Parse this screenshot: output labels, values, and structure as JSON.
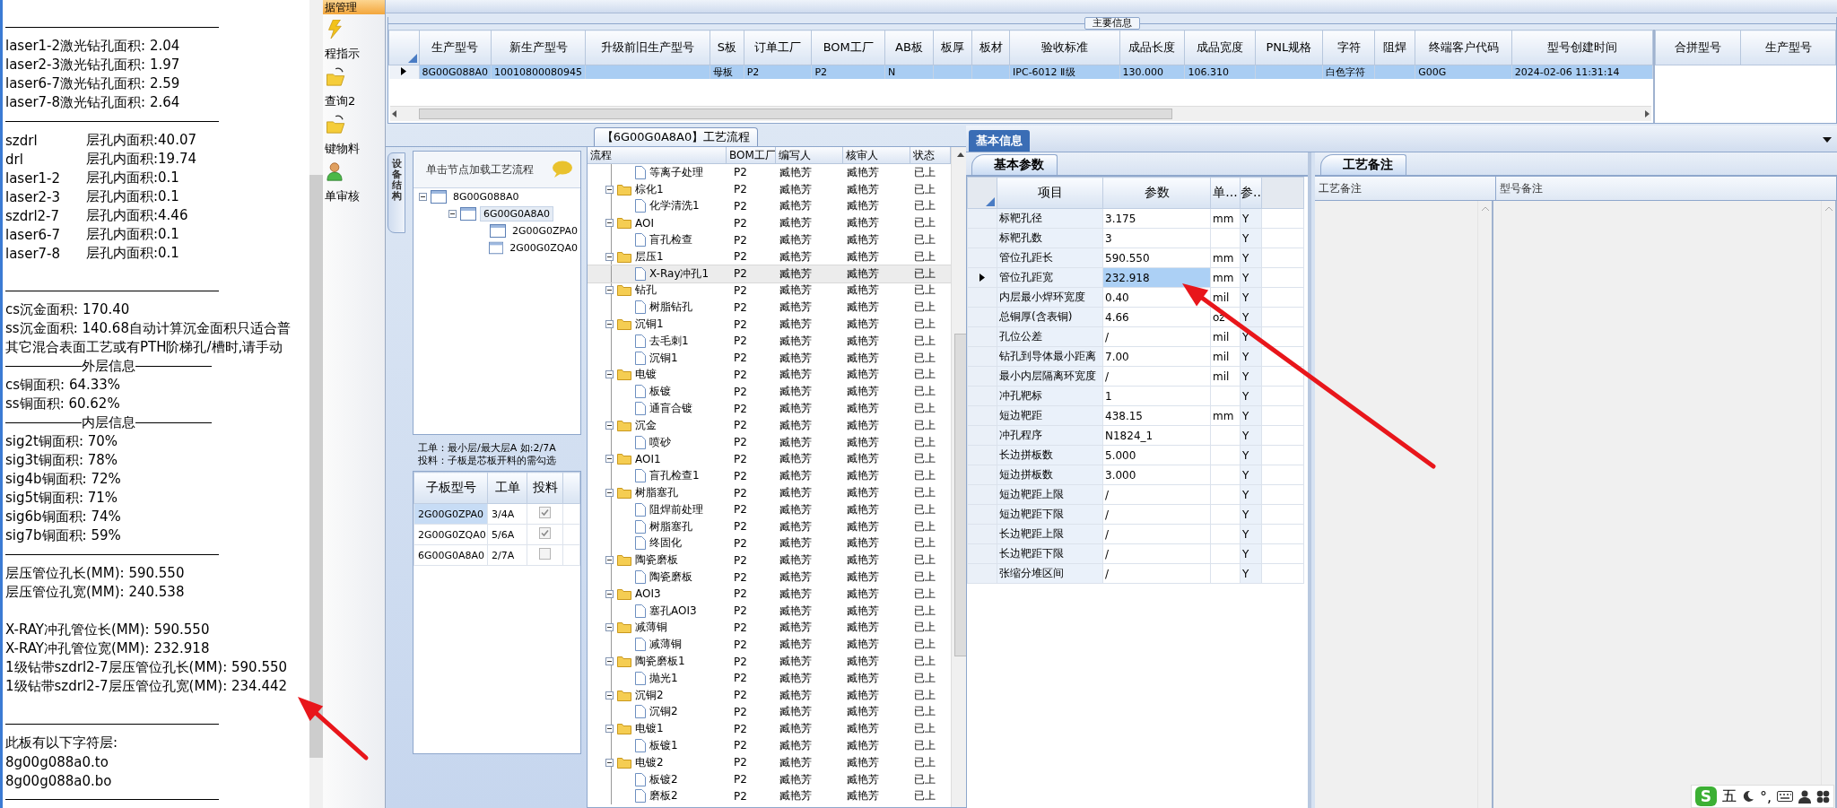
{
  "left_notes": {
    "lines": [
      {
        "kind": "rule"
      },
      {
        "kind": "text",
        "text": "laser1-2激光钻孔面积: 2.04"
      },
      {
        "kind": "text",
        "text": "laser2-3激光钻孔面积: 1.97"
      },
      {
        "kind": "text",
        "text": "laser6-7激光钻孔面积: 2.59"
      },
      {
        "kind": "text",
        "text": "laser7-8激光钻孔面积: 2.64"
      },
      {
        "kind": "rule"
      },
      {
        "kind": "pair",
        "label": "szdrl",
        "value": "层孔内面积:40.07"
      },
      {
        "kind": "pair",
        "label": "drl",
        "value": "层孔内面积:19.74"
      },
      {
        "kind": "pair",
        "label": "laser1-2",
        "value": "层孔内面积:0.1"
      },
      {
        "kind": "pair",
        "label": "laser2-3",
        "value": "层孔内面积:0.1"
      },
      {
        "kind": "pair",
        "label": "szdrl2-7",
        "value": "层孔内面积:4.46"
      },
      {
        "kind": "pair",
        "label": "laser6-7",
        "value": "层孔内面积:0.1"
      },
      {
        "kind": "pair",
        "label": "laser7-8",
        "value": "层孔内面积:0.1"
      },
      {
        "kind": "blank"
      },
      {
        "kind": "rule"
      },
      {
        "kind": "text",
        "text": "cs沉金面积: 170.40"
      },
      {
        "kind": "text",
        "text": "ss沉金面积: 140.68自动计算沉金面积只适合普"
      },
      {
        "kind": "text",
        "text": "其它混合表面工艺或有PTH阶梯孔/槽时,请手动"
      },
      {
        "kind": "heading",
        "text": "外层信息"
      },
      {
        "kind": "text",
        "text": "cs铜面积: 64.33%"
      },
      {
        "kind": "text",
        "text": "ss铜面积: 60.62%"
      },
      {
        "kind": "heading",
        "text": "内层信息"
      },
      {
        "kind": "text",
        "text": "sig2t铜面积: 70%"
      },
      {
        "kind": "text",
        "text": "sig3t铜面积: 78%"
      },
      {
        "kind": "text",
        "text": "sig4b铜面积: 72%"
      },
      {
        "kind": "text",
        "text": "sig5t铜面积: 71%"
      },
      {
        "kind": "text",
        "text": "sig6b铜面积: 74%"
      },
      {
        "kind": "text",
        "text": "sig7b铜面积: 59%"
      },
      {
        "kind": "rule"
      },
      {
        "kind": "text",
        "text": "层压管位孔长(MM): 590.550"
      },
      {
        "kind": "text",
        "text": "层压管位孔宽(MM): 240.538"
      },
      {
        "kind": "blank"
      },
      {
        "kind": "text",
        "text": "X-RAY冲孔管位长(MM): 590.550"
      },
      {
        "kind": "text",
        "text": "X-RAY冲孔管位宽(MM): 232.918"
      },
      {
        "kind": "text",
        "text": "1级钻带szdrl2-7层压管位孔长(MM): 590.550"
      },
      {
        "kind": "text",
        "text": "1级钻带szdrl2-7层压管位孔宽(MM): 234.442"
      },
      {
        "kind": "blank"
      },
      {
        "kind": "rule"
      },
      {
        "kind": "text",
        "text": "此板有以下字符层:"
      },
      {
        "kind": "text",
        "text": "8g00g088a0.to"
      },
      {
        "kind": "text",
        "text": "8g00g088a0.bo"
      },
      {
        "kind": "rule"
      }
    ]
  },
  "side_menu": {
    "header": "据管理",
    "items": [
      {
        "label": "程指示"
      },
      {
        "label": "查询2"
      },
      {
        "label": "键物料"
      },
      {
        "label": "单审核"
      }
    ]
  },
  "top_table": {
    "title": "主要信息",
    "columns": [
      "生产型号",
      "新生产型号",
      "升级前旧生产型号",
      "S板",
      "订单工厂",
      "BOM工厂",
      "AB板",
      "板厚",
      "板材",
      "验收标准",
      "成品长度",
      "成品宽度",
      "PNL规格",
      "字符",
      "阻焊",
      "终端客户代码",
      "型号创建时间"
    ],
    "rows": [
      {
        "selected": true,
        "cells": [
          "8G00G088A0",
          "10010800080945",
          null,
          "母板",
          "P2",
          "P2",
          "N",
          null,
          null,
          "IPC-6012 Ⅱ级",
          "130.000",
          "106.310",
          null,
          "白色字符",
          null,
          "G00G",
          "2024-02-06 11:31:14"
        ]
      }
    ]
  },
  "merge_table": {
    "columns": [
      "合拼型号",
      "生产型号"
    ]
  },
  "process": {
    "title": "【6G00G0A8A0】工艺流程",
    "side_tab": "设备结构",
    "tree_header": "单击节点加载工艺流程",
    "tree": [
      {
        "label": "8G00G088A0",
        "expanded": true,
        "selected": false,
        "children": [
          {
            "label": "6G00G0A8A0",
            "expanded": true,
            "selected": true,
            "children": [
              {
                "label": "2G00G0ZPA0",
                "selected": false
              },
              {
                "label": "2G00G0ZQA0",
                "selected": false
              }
            ]
          }
        ]
      }
    ],
    "hints": [
      "工单：最小层/最大层A 如:2/7A",
      "投料：子板是芯板开料的需勾选"
    ],
    "sub_table": {
      "columns": [
        "子板型号",
        "工单",
        "投料"
      ],
      "rows": [
        {
          "model": "2G00G0ZPA0",
          "order": "3/4A",
          "checked": true,
          "selected": true
        },
        {
          "model": "2G00G0ZQA0",
          "order": "5/6A",
          "checked": true,
          "selected": false
        },
        {
          "model": "6G00G0A8A0",
          "order": "2/7A",
          "checked": false,
          "selected": false
        }
      ]
    },
    "flow": {
      "columns": [
        "流程",
        "BOM工厂",
        "编写人",
        "核审人",
        "状态"
      ],
      "rows": [
        {
          "children": [
            {
              "name": "等离子处理",
              "selected": false,
              "bom": "P2",
              "writer": "臧艳芳",
              "reviewer": "臧艳芳",
              "status": "已上"
            }
          ]
        },
        {
          "name": "棕化1",
          "expanded": true,
          "selected": false,
          "bom": "P2",
          "writer": "臧艳芳",
          "reviewer": "臧艳芳",
          "status": "已上",
          "children": [
            {
              "name": "化学清洗1",
              "selected": false,
              "bom": "P2",
              "writer": "臧艳芳",
              "reviewer": "臧艳芳",
              "status": "已上"
            }
          ]
        },
        {
          "name": "AOI",
          "expanded": true,
          "selected": false,
          "bom": "P2",
          "writer": "臧艳芳",
          "reviewer": "臧艳芳",
          "status": "已上",
          "children": [
            {
              "name": "盲孔检查",
              "selected": false,
              "bom": "P2",
              "writer": "臧艳芳",
              "reviewer": "臧艳芳",
              "status": "已上"
            }
          ]
        },
        {
          "name": "层压1",
          "expanded": true,
          "selected": false,
          "bom": "P2",
          "writer": "臧艳芳",
          "reviewer": "臧艳芳",
          "status": "已上",
          "children": [
            {
              "name": "X-Ray冲孔1",
              "selected": true,
              "bom": "P2",
              "writer": "臧艳芳",
              "reviewer": "臧艳芳",
              "status": "已上"
            }
          ]
        },
        {
          "name": "钻孔",
          "expanded": true,
          "selected": false,
          "bom": "P2",
          "writer": "臧艳芳",
          "reviewer": "臧艳芳",
          "status": "已上",
          "children": [
            {
              "name": "树脂钻孔",
              "selected": false,
              "bom": "P2",
              "writer": "臧艳芳",
              "reviewer": "臧艳芳",
              "status": "已上"
            }
          ]
        },
        {
          "name": "沉铜1",
          "expanded": true,
          "selected": false,
          "bom": "P2",
          "writer": "臧艳芳",
          "reviewer": "臧艳芳",
          "status": "已上",
          "children": [
            {
              "name": "去毛刺1",
              "selected": false,
              "bom": "P2",
              "writer": "臧艳芳",
              "reviewer": "臧艳芳",
              "status": "已上"
            },
            {
              "name": "沉铜1",
              "selected": false,
              "bom": "P2",
              "writer": "臧艳芳",
              "reviewer": "臧艳芳",
              "status": "已上"
            }
          ]
        },
        {
          "name": "电镀",
          "expanded": true,
          "selected": false,
          "bom": "P2",
          "writer": "臧艳芳",
          "reviewer": "臧艳芳",
          "status": "已上",
          "children": [
            {
              "name": "板镀",
              "selected": false,
              "bom": "P2",
              "writer": "臧艳芳",
              "reviewer": "臧艳芳",
              "status": "已上"
            },
            {
              "name": "通盲合镀",
              "selected": false,
              "bom": "P2",
              "writer": "臧艳芳",
              "reviewer": "臧艳芳",
              "status": "已上"
            }
          ]
        },
        {
          "name": "沉金",
          "expanded": true,
          "selected": false,
          "bom": "P2",
          "writer": "臧艳芳",
          "reviewer": "臧艳芳",
          "status": "已上",
          "children": [
            {
              "name": "喷砂",
              "selected": false,
              "bom": "P2",
              "writer": "臧艳芳",
              "reviewer": "臧艳芳",
              "status": "已上"
            }
          ]
        },
        {
          "name": "AOI1",
          "expanded": true,
          "selected": false,
          "bom": "P2",
          "writer": "臧艳芳",
          "reviewer": "臧艳芳",
          "status": "已上",
          "children": [
            {
              "name": "盲孔检查1",
              "selected": false,
              "bom": "P2",
              "writer": "臧艳芳",
              "reviewer": "臧艳芳",
              "status": "已上"
            }
          ]
        },
        {
          "name": "树脂塞孔",
          "expanded": true,
          "selected": false,
          "bom": "P2",
          "writer": "臧艳芳",
          "reviewer": "臧艳芳",
          "status": "已上",
          "children": [
            {
              "name": "阻焊前处理",
              "selected": false,
              "bom": "P2",
              "writer": "臧艳芳",
              "reviewer": "臧艳芳",
              "status": "已上"
            },
            {
              "name": "树脂塞孔",
              "selected": false,
              "bom": "P2",
              "writer": "臧艳芳",
              "reviewer": "臧艳芳",
              "status": "已上"
            },
            {
              "name": "终固化",
              "selected": false,
              "bom": "P2",
              "writer": "臧艳芳",
              "reviewer": "臧艳芳",
              "status": "已上"
            }
          ]
        },
        {
          "name": "陶瓷磨板",
          "expanded": true,
          "selected": false,
          "bom": "P2",
          "writer": "臧艳芳",
          "reviewer": "臧艳芳",
          "status": "已上",
          "children": [
            {
              "name": "陶瓷磨板",
              "selected": false,
              "bom": "P2",
              "writer": "臧艳芳",
              "reviewer": "臧艳芳",
              "status": "已上"
            }
          ]
        },
        {
          "name": "AOI3",
          "expanded": true,
          "selected": false,
          "bom": "P2",
          "writer": "臧艳芳",
          "reviewer": "臧艳芳",
          "status": "已上",
          "children": [
            {
              "name": "塞孔AOI3",
              "selected": false,
              "bom": "P2",
              "writer": "臧艳芳",
              "reviewer": "臧艳芳",
              "status": "已上"
            }
          ]
        },
        {
          "name": "减薄铜",
          "expanded": true,
          "selected": false,
          "bom": "P2",
          "writer": "臧艳芳",
          "reviewer": "臧艳芳",
          "status": "已上",
          "children": [
            {
              "name": "减薄铜",
              "selected": false,
              "bom": "P2",
              "writer": "臧艳芳",
              "reviewer": "臧艳芳",
              "status": "已上"
            }
          ]
        },
        {
          "name": "陶瓷磨板1",
          "expanded": true,
          "selected": false,
          "bom": "P2",
          "writer": "臧艳芳",
          "reviewer": "臧艳芳",
          "status": "已上",
          "children": [
            {
              "name": "抛光1",
              "selected": false,
              "bom": "P2",
              "writer": "臧艳芳",
              "reviewer": "臧艳芳",
              "status": "已上"
            }
          ]
        },
        {
          "name": "沉铜2",
          "expanded": true,
          "selected": false,
          "bom": "P2",
          "writer": "臧艳芳",
          "reviewer": "臧艳芳",
          "status": "已上",
          "children": [
            {
              "name": "沉铜2",
              "selected": false,
              "bom": "P2",
              "writer": "臧艳芳",
              "reviewer": "臧艳芳",
              "status": "已上"
            }
          ]
        },
        {
          "name": "电镀1",
          "expanded": true,
          "selected": false,
          "bom": "P2",
          "writer": "臧艳芳",
          "reviewer": "臧艳芳",
          "status": "已上",
          "children": [
            {
              "name": "板镀1",
              "selected": false,
              "bom": "P2",
              "writer": "臧艳芳",
              "reviewer": "臧艳芳",
              "status": "已上"
            }
          ]
        },
        {
          "name": "电镀2",
          "expanded": true,
          "selected": false,
          "bom": "P2",
          "writer": "臧艳芳",
          "reviewer": "臧艳芳",
          "status": "已上",
          "children": [
            {
              "name": "板镀2",
              "selected": false,
              "bom": "P2",
              "writer": "臧艳芳",
              "reviewer": "臧艳芳",
              "status": "已上"
            },
            {
              "name": "磨板2",
              "selected": false,
              "bom": "P2",
              "writer": "臧艳芳",
              "reviewer": "臧艳芳",
              "status": "已上"
            }
          ]
        }
      ]
    }
  },
  "info": {
    "tabs": [
      {
        "label": "基本信息",
        "selected": true
      }
    ]
  },
  "params": {
    "tab": {
      "label": "基本参数",
      "selected": true
    },
    "columns": [
      "项目",
      "参数",
      "单...",
      "参.."
    ],
    "rows": [
      {
        "item": "标靶孔径",
        "value": "3.175",
        "unit": "mm",
        "flag": "Y",
        "selected": false
      },
      {
        "item": "标靶孔数",
        "value": "3",
        "unit": null,
        "flag": "Y",
        "selected": false
      },
      {
        "item": "管位孔距长",
        "value": "590.550",
        "unit": "mm",
        "flag": "Y",
        "selected": false
      },
      {
        "item": "管位孔距宽",
        "value": "232.918",
        "unit": "mm",
        "flag": "Y",
        "selected": true
      },
      {
        "item": "内层最小焊环宽度",
        "value": "0.40",
        "unit": "mil",
        "flag": "Y",
        "selected": false
      },
      {
        "item": "总铜厚(含表铜)",
        "value": "4.66",
        "unit": "oz",
        "flag": "Y",
        "selected": false
      },
      {
        "item": "孔位公差",
        "value": "/",
        "unit": "mil",
        "flag": "Y",
        "selected": false
      },
      {
        "item": "钻孔到导体最小距离",
        "value": "7.00",
        "unit": "mil",
        "flag": "Y",
        "selected": false
      },
      {
        "item": "最小内层隔离环宽度",
        "value": "/",
        "unit": "mil",
        "flag": "Y",
        "selected": false
      },
      {
        "item": "冲孔靶标",
        "value": "1",
        "unit": null,
        "flag": "Y",
        "selected": false
      },
      {
        "item": "短边靶距",
        "value": "438.15",
        "unit": "mm",
        "flag": "Y",
        "selected": false
      },
      {
        "item": "冲孔程序",
        "value": "N1824_1",
        "unit": null,
        "flag": "Y",
        "selected": false
      },
      {
        "item": "长边拼板数",
        "value": "5.000",
        "unit": null,
        "flag": "Y",
        "selected": false
      },
      {
        "item": "短边拼板数",
        "value": "3.000",
        "unit": null,
        "flag": "Y",
        "selected": false
      },
      {
        "item": "短边靶距上限",
        "value": "/",
        "unit": null,
        "flag": "Y",
        "selected": false
      },
      {
        "item": "短边靶距下限",
        "value": "/",
        "unit": null,
        "flag": "Y",
        "selected": false
      },
      {
        "item": "长边靶距上限",
        "value": "/",
        "unit": null,
        "flag": "Y",
        "selected": false
      },
      {
        "item": "长边靶距下限",
        "value": "/",
        "unit": null,
        "flag": "Y",
        "selected": false
      },
      {
        "item": "张缩分堆区间",
        "value": "/",
        "unit": null,
        "flag": "Y",
        "selected": false
      }
    ]
  },
  "remarks": {
    "tab": {
      "label": "工艺备注",
      "selected": true
    },
    "columns": [
      "工艺备注",
      "型号备注"
    ]
  },
  "tray": {
    "logo": "S",
    "mode": "五",
    "punct": "°,"
  }
}
